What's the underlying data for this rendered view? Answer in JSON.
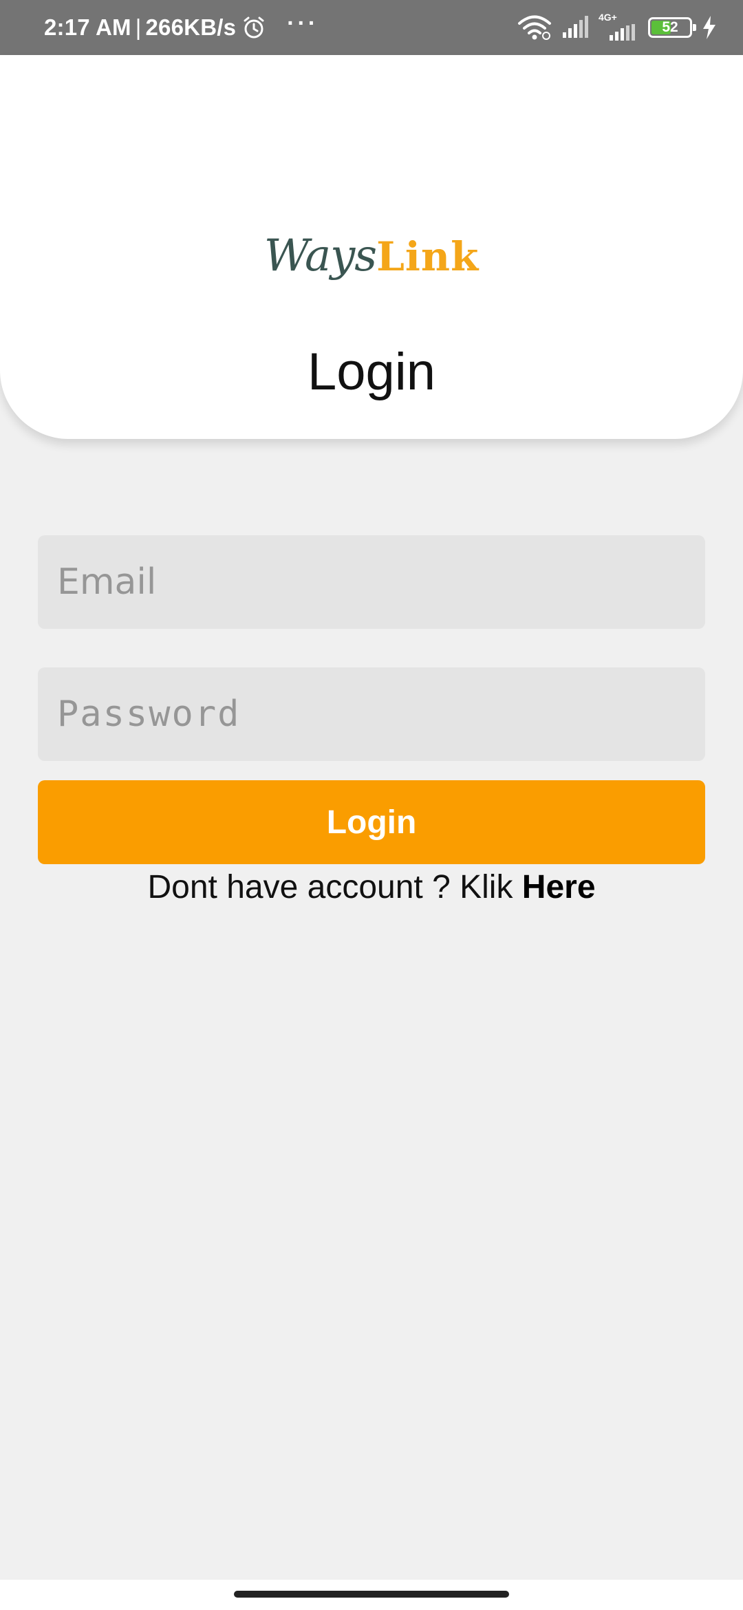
{
  "status_bar": {
    "time": "2:17 AM",
    "separator": "|",
    "speed": "266KB/s",
    "more_label": "···",
    "network_type": "4G+",
    "battery_level": "52",
    "battery_fraction": 0.52,
    "battery_color": "#5bbf3a",
    "icons": [
      "alarm-icon",
      "wifi-icon",
      "signal-icon",
      "charging-icon"
    ]
  },
  "header": {
    "logo": {
      "part1": "Ways",
      "part2": "Link"
    },
    "title": "Login"
  },
  "form": {
    "email": {
      "value": "",
      "placeholder": "Email"
    },
    "password": {
      "value": "",
      "placeholder": "Password"
    },
    "login_button": "Login",
    "signup_prompt": "Dont have account ? Klik ",
    "signup_link": "Here"
  },
  "colors": {
    "accent": "#fa9d00",
    "background": "#f0f0f0",
    "field_background": "#e4e4e4",
    "status_bar": "#747474"
  }
}
